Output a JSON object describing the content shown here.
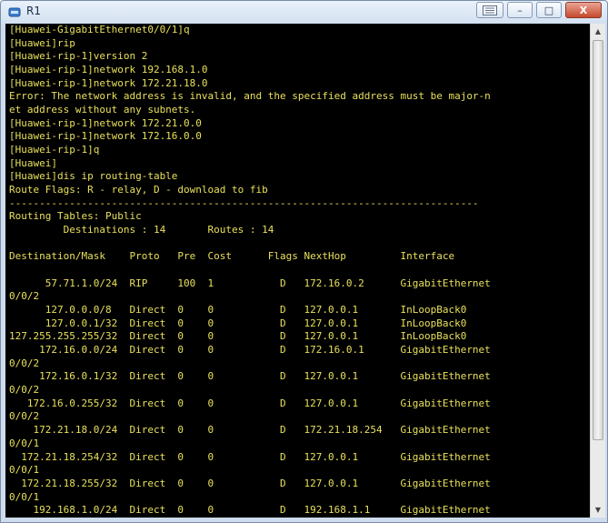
{
  "window": {
    "title": "R1",
    "buttons": {
      "restore_icon": "restore-icon",
      "minimize_label": "–",
      "maximize_label": "□",
      "close_label": "X"
    }
  },
  "console": {
    "text_color": "#e8e05a",
    "background_color": "#000000",
    "lines": [
      "[Huawei-GigabitEthernet0/0/1]q",
      "[Huawei]rip",
      "[Huawei-rip-1]version 2",
      "[Huawei-rip-1]network 192.168.1.0",
      "[Huawei-rip-1]network 172.21.18.0",
      "Error: The network address is invalid, and the specified address must be major-n",
      "et address without any subnets.",
      "[Huawei-rip-1]network 172.21.0.0",
      "[Huawei-rip-1]network 172.16.0.0",
      "[Huawei-rip-1]q",
      "[Huawei]",
      "[Huawei]dis ip routing-table",
      "Route Flags: R - relay, D - download to fib",
      "------------------------------------------------------------------------------",
      "Routing Tables: Public",
      "         Destinations : 14       Routes : 14",
      "",
      "Destination/Mask    Proto   Pre  Cost      Flags NextHop         Interface",
      "",
      "      57.71.1.0/24  RIP     100  1           D   172.16.0.2      GigabitEthernet",
      "0/0/2",
      "      127.0.0.0/8   Direct  0    0           D   127.0.0.1       InLoopBack0",
      "      127.0.0.1/32  Direct  0    0           D   127.0.0.1       InLoopBack0",
      "127.255.255.255/32  Direct  0    0           D   127.0.0.1       InLoopBack0",
      "     172.16.0.0/24  Direct  0    0           D   172.16.0.1      GigabitEthernet",
      "0/0/2",
      "     172.16.0.1/32  Direct  0    0           D   127.0.0.1       GigabitEthernet",
      "0/0/2",
      "   172.16.0.255/32  Direct  0    0           D   127.0.0.1       GigabitEthernet",
      "0/0/2",
      "    172.21.18.0/24  Direct  0    0           D   172.21.18.254   GigabitEthernet",
      "0/0/1",
      "  172.21.18.254/32  Direct  0    0           D   127.0.0.1       GigabitEthernet",
      "0/0/1",
      "  172.21.18.255/32  Direct  0    0           D   127.0.0.1       GigabitEthernet",
      "0/0/1",
      "    192.168.1.0/24  Direct  0    0           D   192.168.1.1     GigabitEthernet"
    ]
  }
}
